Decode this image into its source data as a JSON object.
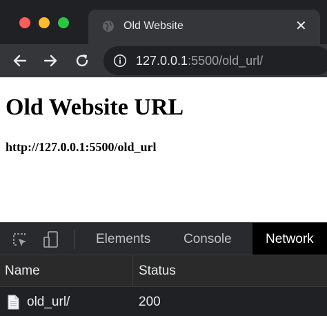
{
  "tab": {
    "title": "Old Website",
    "close_glyph": "✕",
    "icon": "globe-icon"
  },
  "toolbar": {
    "back_icon": "arrow-left-icon",
    "forward_icon": "arrow-right-icon",
    "reload_icon": "reload-icon",
    "info_icon": "info-icon",
    "url_host": "127.0.0.1",
    "url_rest": ":5500/old_url/"
  },
  "page": {
    "heading": "Old Website URL",
    "paragraph": "http://127.0.0.1:5500/old_url"
  },
  "devtools": {
    "tabs": [
      "Elements",
      "Console",
      "Network"
    ],
    "active_tab": "Network",
    "columns": {
      "name": "Name",
      "status": "Status"
    },
    "rows": [
      {
        "name": "old_url/",
        "status": "200"
      }
    ]
  },
  "colors": {
    "tabstrip_bg": "#202124",
    "toolbar_bg": "#35363a",
    "omnibox_bg": "#202124",
    "devtools_bg": "#242424",
    "traffic_red": "#ff5f57",
    "traffic_yellow": "#febc2e",
    "traffic_green": "#28c840"
  }
}
